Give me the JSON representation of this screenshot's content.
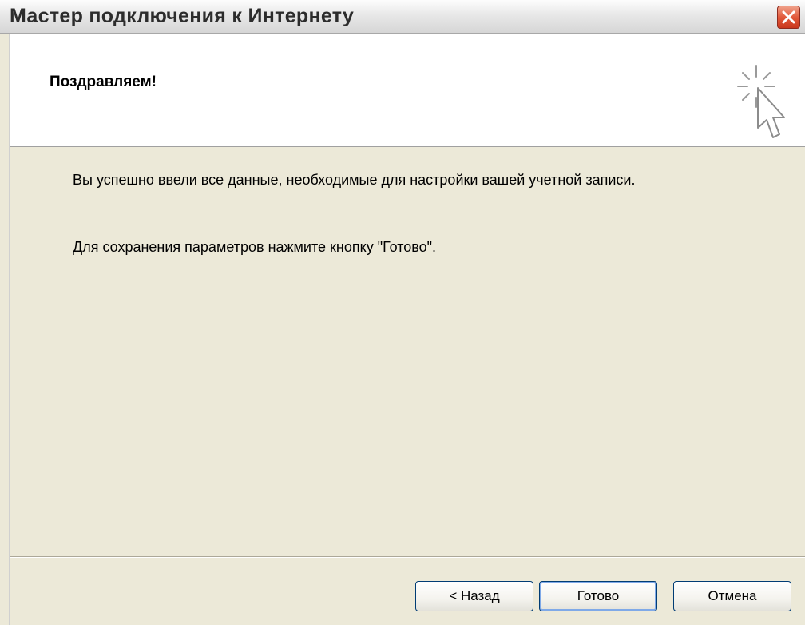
{
  "window": {
    "title": "Мастер подключения к Интернету",
    "close_icon": "close-icon"
  },
  "header": {
    "heading": "Поздравляем!",
    "wizard_icon": "pointer-cursor-sparkle-icon"
  },
  "body": {
    "paragraph_1": "Вы успешно ввели все данные, необходимые для настройки вашей учетной записи.",
    "paragraph_2": "Для сохранения параметров нажмите кнопку \"Готово\"."
  },
  "buttons": {
    "back": "< Назад",
    "finish": "Готово",
    "cancel": "Отмена"
  },
  "colors": {
    "close_button": "#e2593b",
    "default_button_focus": "#7fa9e8",
    "dialog_background": "#ece9d8"
  }
}
